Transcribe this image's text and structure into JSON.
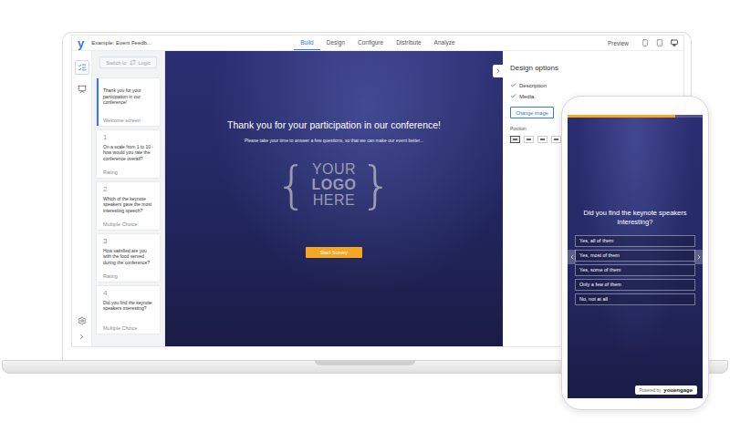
{
  "app": {
    "brand": "y",
    "survey_title": "Example: Event Feedb...",
    "tabs": [
      {
        "label": "Build",
        "selected": true
      },
      {
        "label": "Design",
        "selected": false
      },
      {
        "label": "Configure",
        "selected": false
      },
      {
        "label": "Distribute",
        "selected": false
      },
      {
        "label": "Analyze",
        "selected": false
      }
    ],
    "preview_label": "Preview",
    "devices": [
      {
        "kind": "phone",
        "selected": false
      },
      {
        "kind": "tablet",
        "selected": false
      },
      {
        "kind": "desktop",
        "selected": true
      }
    ]
  },
  "rail": {
    "items": [
      {
        "kind": "questions",
        "selected": true
      },
      {
        "kind": "presentation",
        "selected": false
      }
    ]
  },
  "switch_logic": {
    "prefix": "Switch to",
    "label": "Logic"
  },
  "questions": [
    {
      "number": "",
      "text": "Thank you for your participation in our conference!",
      "type": "Welcome screen",
      "selected": true
    },
    {
      "number": "1",
      "text": "On a scale from 1 to 10 - how would you rate the conference overall?",
      "type": "Rating",
      "selected": false
    },
    {
      "number": "2",
      "text": "Which of the keynote speakers gave the most interesting speech?",
      "type": "Multiple Choice",
      "selected": false
    },
    {
      "number": "3",
      "text": "How satisfied are you with the food served during the conference?",
      "type": "Rating",
      "selected": false
    },
    {
      "number": "4",
      "text": "Did you find the keynote speakers interesting?",
      "type": "Multiple Choice",
      "selected": false
    }
  ],
  "preview": {
    "title": "Thank you for your participation in our conference!",
    "subtitle": "Please take your time to answer a few questions, so that we can make our event better...",
    "logo": {
      "brace_open": "{",
      "lines": [
        "YOUR",
        "LOGO",
        "HERE"
      ],
      "brace_close": "}"
    },
    "button": "Start Survey"
  },
  "design": {
    "title": "Design options",
    "options": [
      {
        "label": "Description",
        "checked": true
      },
      {
        "label": "Media",
        "checked": true
      }
    ],
    "change_image": "Change image",
    "position_label": "Position",
    "positions": [
      {
        "selected": true
      },
      {
        "selected": false
      },
      {
        "selected": false
      },
      {
        "selected": false
      }
    ]
  },
  "phone": {
    "progress": {
      "level": 0.8
    },
    "question": "Did you find the keynote speakers interesting?",
    "answers": [
      "Yes, all of them",
      "Yes, most of them",
      "Yes, some of them",
      "Only a few of them",
      "No, not at all"
    ],
    "powered_by": "Powered by",
    "brand": "youengage"
  }
}
